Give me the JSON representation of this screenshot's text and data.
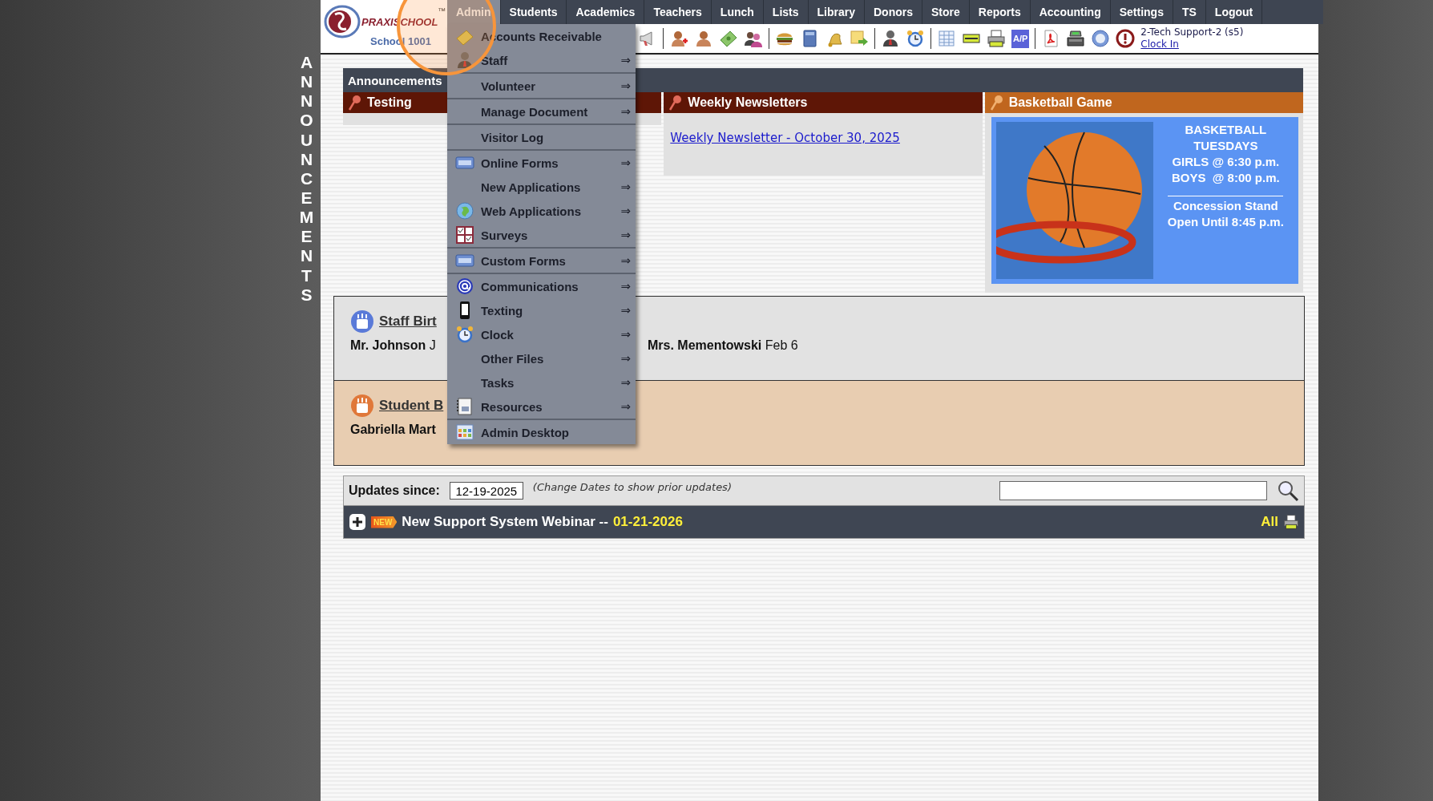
{
  "side_banner": {
    "text": "ANNOUNCEMENTS"
  },
  "logo": {
    "brand": "PRAXISCHOOL",
    "trademark": "™",
    "school": "School 1001"
  },
  "nav": [
    {
      "label": "Admin",
      "selected": true
    },
    {
      "label": "Students",
      "selected": false
    },
    {
      "label": "Academics",
      "selected": false
    },
    {
      "label": "Teachers",
      "selected": false
    },
    {
      "label": "Lunch",
      "selected": false
    },
    {
      "label": "Lists",
      "selected": false
    },
    {
      "label": "Library",
      "selected": false
    },
    {
      "label": "Donors",
      "selected": false
    },
    {
      "label": "Store",
      "selected": false
    },
    {
      "label": "Reports",
      "selected": false
    },
    {
      "label": "Accounting",
      "selected": false
    },
    {
      "label": "Settings",
      "selected": false
    },
    {
      "label": "TS",
      "selected": false
    },
    {
      "label": "Logout",
      "selected": false
    }
  ],
  "toolbar": {
    "ap_label": "A/P"
  },
  "user": {
    "name": "2-Tech Support-2 (s5)",
    "clock_link": "Clock In"
  },
  "admin_menu": {
    "groups": [
      [
        {
          "label": "Accounts Receivable"
        },
        {
          "label": "Staff",
          "arrow": "⇒"
        }
      ],
      [
        {
          "label": "Volunteer",
          "arrow": "⇒"
        }
      ],
      [
        {
          "label": "Manage Document",
          "arrow": "⇒"
        }
      ],
      [
        {
          "label": "Visitor Log"
        }
      ],
      [
        {
          "label": "Online Forms",
          "arrow": "⇒"
        },
        {
          "label": "New Applications",
          "arrow": "⇒"
        },
        {
          "label": "Web Applications",
          "arrow": "⇒"
        },
        {
          "label": "Surveys",
          "arrow": "⇒"
        }
      ],
      [
        {
          "label": "Custom Forms",
          "arrow": "⇒"
        }
      ],
      [
        {
          "label": "Communications",
          "arrow": "⇒"
        },
        {
          "label": "Texting",
          "arrow": "⇒"
        },
        {
          "label": "Clock",
          "arrow": "⇒"
        },
        {
          "label": "Other Files",
          "arrow": "⇒"
        },
        {
          "label": "Tasks",
          "arrow": "⇒"
        },
        {
          "label": "Resources",
          "arrow": "⇒"
        }
      ],
      [
        {
          "label": "Admin Desktop"
        }
      ]
    ]
  },
  "announcements": {
    "title": "Announcements",
    "panels": [
      {
        "kind": "plain",
        "title": "Testing",
        "color": "#5e1606"
      },
      {
        "kind": "links",
        "title": "Weekly Newsletters",
        "color": "#5e1606",
        "links": [
          "Weekly Newsletter - October 30, 2025"
        ]
      },
      {
        "kind": "flyer",
        "title": "Basketball Game",
        "color": "#c0661e",
        "lines": [
          "BASKETBALL",
          "TUESDAYS",
          "GIRLS @ 6:30 p.m.",
          "BOYS  @ 8:00 p.m."
        ],
        "footer_lines": [
          "Concession Stand",
          "Open Until 8:45 p.m."
        ]
      }
    ]
  },
  "staff_birthdays": {
    "title": "Staff Birt",
    "people": [
      {
        "name": "Mr. Johnson",
        "date": "J"
      },
      {
        "name": "Mrs. Mementowski",
        "date": "Feb 6"
      }
    ]
  },
  "student_birthdays": {
    "title": "Student B",
    "people": [
      {
        "name": "Gabriella Mart"
      }
    ]
  },
  "updates": {
    "label": "Updates since:",
    "date": "12-19-2025",
    "hint": "(Change Dates to show prior updates)",
    "entries": [
      {
        "expanded": false,
        "badge": "NEW",
        "title": "New Support System Webinar --",
        "date": "01-21-2026"
      }
    ],
    "all_link": "All"
  }
}
